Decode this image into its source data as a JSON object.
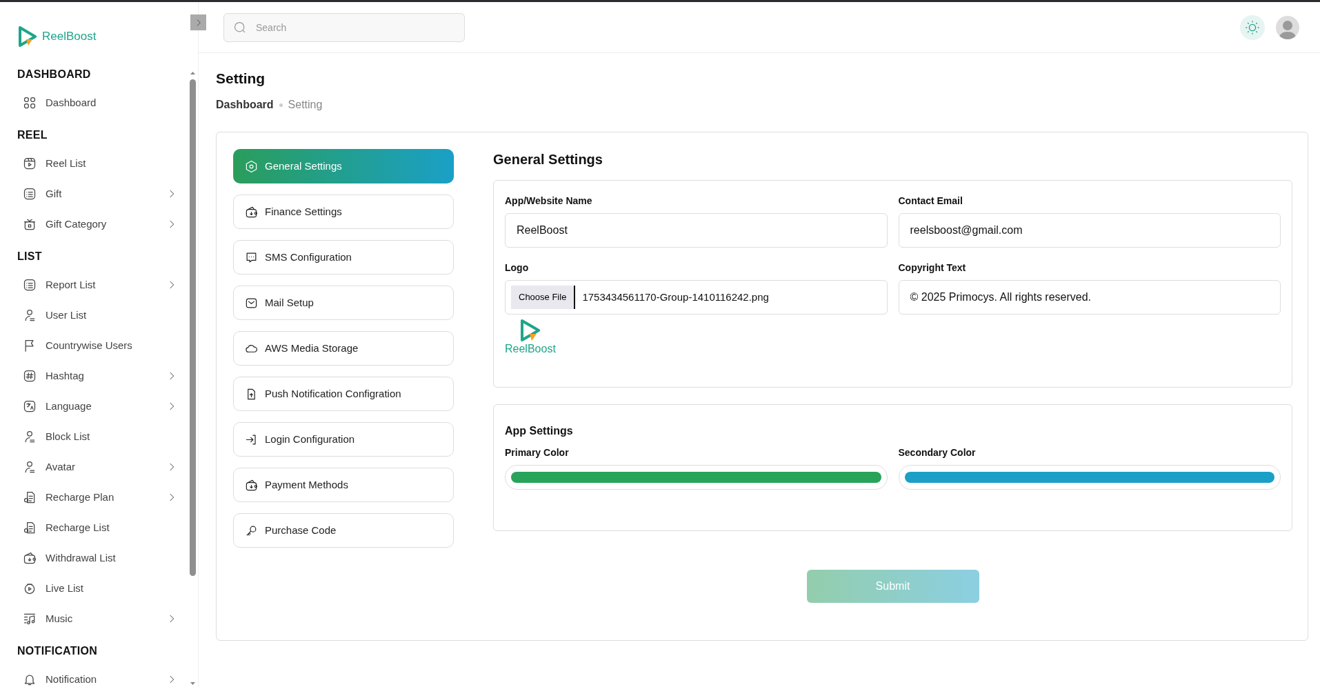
{
  "sidebar": {
    "brand": "ReelBoost",
    "sections": [
      {
        "heading": "DASHBOARD",
        "items": [
          {
            "label": "Dashboard",
            "submenu": false
          }
        ]
      },
      {
        "heading": "REEL",
        "items": [
          {
            "label": "Reel List",
            "submenu": false
          },
          {
            "label": "Gift",
            "submenu": true
          },
          {
            "label": "Gift Category",
            "submenu": true
          }
        ]
      },
      {
        "heading": "LIST",
        "items": [
          {
            "label": "Report List",
            "submenu": true
          },
          {
            "label": "User List",
            "submenu": false
          },
          {
            "label": "Countrywise Users",
            "submenu": false
          },
          {
            "label": "Hashtag",
            "submenu": true
          },
          {
            "label": "Language",
            "submenu": true
          },
          {
            "label": "Block List",
            "submenu": false
          },
          {
            "label": "Avatar",
            "submenu": true
          },
          {
            "label": "Recharge Plan",
            "submenu": true
          },
          {
            "label": "Recharge List",
            "submenu": false
          },
          {
            "label": "Withdrawal List",
            "submenu": false
          },
          {
            "label": "Live List",
            "submenu": false
          },
          {
            "label": "Music",
            "submenu": true
          }
        ]
      },
      {
        "heading": "NOTIFICATION",
        "items": [
          {
            "label": "Notification",
            "submenu": true
          }
        ]
      }
    ]
  },
  "search": {
    "placeholder": "Search"
  },
  "page": {
    "title": "Setting",
    "breadcrumb": [
      {
        "label": "Dashboard",
        "current": false
      },
      {
        "label": "Setting",
        "current": true
      }
    ]
  },
  "settings_menu": [
    {
      "label": "General Settings",
      "selected": true
    },
    {
      "label": "Finance Settings",
      "selected": false
    },
    {
      "label": "SMS Configuration",
      "selected": false
    },
    {
      "label": "Mail Setup",
      "selected": false
    },
    {
      "label": "AWS Media Storage",
      "selected": false
    },
    {
      "label": "Push Notification Configration",
      "selected": false
    },
    {
      "label": "Login Configuration",
      "selected": false
    },
    {
      "label": "Payment Methods",
      "selected": false
    },
    {
      "label": "Purchase Code",
      "selected": false
    }
  ],
  "general": {
    "title": "General Settings",
    "fields": [
      {
        "kind": "text",
        "label": "App/Website Name",
        "value": "ReelBoost"
      },
      {
        "kind": "text",
        "label": "Contact Email",
        "value": "reelsboost@gmail.com"
      },
      {
        "kind": "file",
        "label": "Logo",
        "button": "Choose File",
        "value": "1753434561170-Group-1410116242.png",
        "preview": "ReelBoost"
      },
      {
        "kind": "text",
        "label": "Copyright Text",
        "value": "© 2025 Primocys. All rights reserved."
      }
    ]
  },
  "app_settings": {
    "title": "App Settings",
    "colors": [
      {
        "label": "Primary Color",
        "color": "#27a35a"
      },
      {
        "label": "Secondary Color",
        "color": "#1b9fc6"
      }
    ]
  },
  "submit": {
    "label": "Submit",
    "disabled": true
  }
}
